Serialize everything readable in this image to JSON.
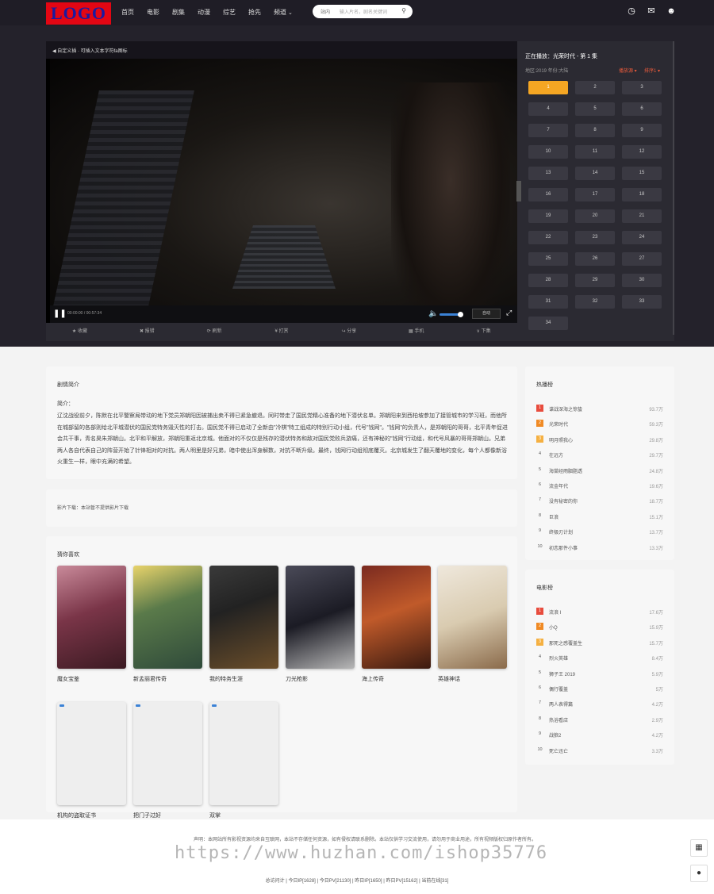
{
  "header": {
    "logo": "LOGO",
    "nav": [
      "首页",
      "电影",
      "剧集",
      "动漫",
      "综艺",
      "抢先",
      "频道"
    ],
    "search": {
      "category": "站内",
      "placeholder": "输入片名，剧名关键词"
    },
    "icons": [
      "clock-icon",
      "message-icon",
      "user-icon"
    ]
  },
  "player": {
    "title_bar": "◀ 自定义插 · 可插入文本字符fa图标",
    "time": "00:00:00 / 00:57:34",
    "auto_label": "自动",
    "volume_level": 0.7,
    "actions": [
      "★ 收藏",
      "✖ 报错",
      "⟳ 刷新",
      "¥ 打赏",
      "↪ 分享",
      "▦ 手机",
      "∨ 下集"
    ]
  },
  "episodes": {
    "now_playing": "正在播放：光荣时代 - 第 1 集",
    "meta": "地区:2019 年份:大陆",
    "sort_a": "播放源 ▾",
    "sort_b": "排序1 ▾",
    "active": "1",
    "list": [
      "1",
      "2",
      "3",
      "4",
      "5",
      "6",
      "7",
      "8",
      "9",
      "10",
      "11",
      "12",
      "13",
      "14",
      "15",
      "16",
      "17",
      "18",
      "19",
      "20",
      "21",
      "22",
      "23",
      "24",
      "25",
      "26",
      "27",
      "28",
      "29",
      "30",
      "31",
      "32",
      "33",
      "34"
    ]
  },
  "intro": {
    "title": "剧情简介",
    "label": "简介：",
    "text": "辽沈战役前夕，陈默在北平警察局带动的地下党员郑朝阳因被捕出卖不得已紧急撤退。同时带走了国民党精心准备的地下潜伏名单。郑朝阳来到西柏坡参加了接管城市的学习班，而他所在城部留的各部则给北平城潜伏的国民党特务毁灭性的打击。国民党不得已启动了全新由\"冷棋\"特工组成的特别行动小组，代号\"钱网\"。\"钱网\"的负责人，是郑朝阳的哥哥，北平青年促进会共干事，青名昊朱郑朝山。北平和平解放，郑朝阳重返北京城。他面对的不仅仅是残存的潜伏特务和敌对国民党败兵游痛，还有神秘的\"钱网\"行动组，和代号风暴的哥哥郑朝山。兄弟两人各自代表自己的阵营开始了针锋相对的对抗。两人明里是好兄弟，暗中使出浑身解数，对抗不断升级。最终，钱网行动组彻底覆灭。北京城发生了翻天覆地的变化，每个人都像新浴火重生一样，眼中充满的希望。"
  },
  "download": {
    "text": "影片下载：本站暂不提供影片下载"
  },
  "recommend": {
    "title": "猜你喜欢",
    "items": [
      {
        "name": "魔女宝鉴",
        "poster": "poster-1"
      },
      {
        "name": "新孟丽君传奇",
        "poster": "poster-2"
      },
      {
        "name": "我的特务生涯",
        "poster": "poster-3"
      },
      {
        "name": "刀光枪影",
        "poster": "poster-4"
      },
      {
        "name": "海上传奇",
        "poster": "poster-5"
      },
      {
        "name": "英雄神话",
        "poster": "poster-6"
      },
      {
        "name": "机构的盗取证书",
        "poster": "blank"
      },
      {
        "name": "把门子过好",
        "poster": "blank"
      },
      {
        "name": "双掌",
        "poster": "blank"
      }
    ]
  },
  "hot_tv": {
    "title": "热播榜",
    "items": [
      {
        "name": "谍战深海之惊蛰",
        "hits": "93.7万"
      },
      {
        "name": "光荣时代",
        "hits": "59.3万"
      },
      {
        "name": "明月照我心",
        "hits": "29.8万"
      },
      {
        "name": "在远方",
        "hits": "29.7万"
      },
      {
        "name": "海棠经雨胭脂透",
        "hits": "24.8万"
      },
      {
        "name": "流金年代",
        "hits": "19.6万"
      },
      {
        "name": "没有秘密的你",
        "hits": "18.7万"
      },
      {
        "name": "巨浪",
        "hits": "15.1万"
      },
      {
        "name": "终极刃计划",
        "hits": "13.7万"
      },
      {
        "name": "初恋那件小事",
        "hits": "13.3万"
      }
    ]
  },
  "hot_movie": {
    "title": "电影榜",
    "items": [
      {
        "name": "流浪 I",
        "hits": "17.6万"
      },
      {
        "name": "小Q",
        "hits": "15.9万"
      },
      {
        "name": "那死之感覆盖生",
        "hits": "15.7万"
      },
      {
        "name": "烈火英雄",
        "hits": "8.4万"
      },
      {
        "name": "狮子王 2019",
        "hits": "5.9万"
      },
      {
        "name": "偶行覆盖",
        "hits": "5万"
      },
      {
        "name": "两人表得篇",
        "hits": "4.2万"
      },
      {
        "name": "热浴看店",
        "hits": "2.9万"
      },
      {
        "name": "战狼2",
        "hits": "4.2万"
      },
      {
        "name": "死亡迅亡",
        "hits": "3.3万"
      }
    ]
  },
  "footer": {
    "note": "声明：本网站所有影视资源均来自互联网，本站不存储任何资源，如有侵权请联系删除。本站仅供学习交流使用，请勿用于商业用途，所有视频版权归原作者所有。",
    "watermark": "https://www.huzhan.com/ishop35776",
    "stats": "总访问计 | 今日IP[1628] | 今日PV[21130] | 昨日IP[1650] | 昨日PV[15162] | 当前在线[31]"
  }
}
